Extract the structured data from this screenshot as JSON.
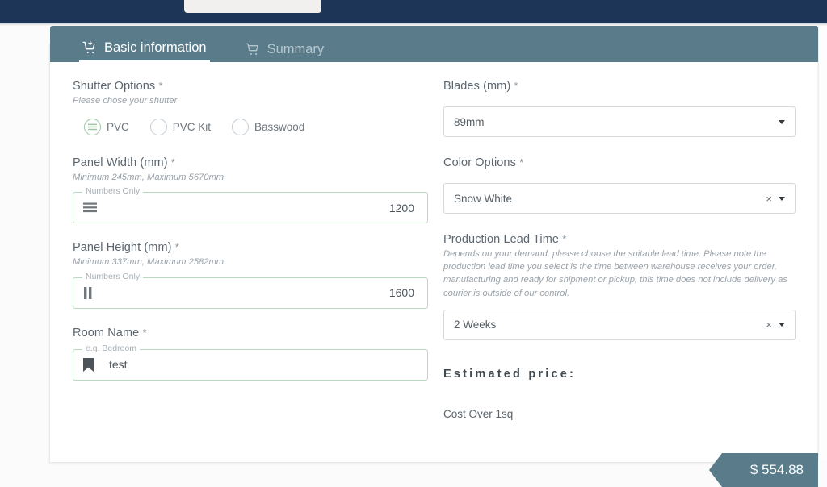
{
  "browser": {
    "tab_strip": "browser-tab"
  },
  "card": {
    "tabs": [
      {
        "label": "Basic information",
        "icon": "cart-add-icon",
        "active": true
      },
      {
        "label": "Summary",
        "icon": "cart-icon",
        "active": false
      }
    ]
  },
  "shutter": {
    "label": "Shutter Options",
    "required": "*",
    "hint": "Please chose your shutter",
    "options": [
      {
        "label": "PVC",
        "selected": true
      },
      {
        "label": "PVC Kit",
        "selected": false
      },
      {
        "label": "Basswood",
        "selected": false
      }
    ]
  },
  "panel_width": {
    "label": "Panel Width (mm)",
    "required": "*",
    "hint": "Minimum 245mm, Maximum 5670mm",
    "float_label": "Numbers Only",
    "value": "1200",
    "icon": "hamburger-lines-icon"
  },
  "panel_height": {
    "label": "Panel Height (mm)",
    "required": "*",
    "hint": "Minimum 337mm, Maximum 2582mm",
    "float_label": "Numbers Only",
    "value": "1600",
    "icon": "vertical-bars-icon"
  },
  "room_name": {
    "label": "Room Name",
    "required": "*",
    "float_label": "e.g. Bedroom",
    "value": "test",
    "icon": "bookmark-icon"
  },
  "blades": {
    "label": "Blades (mm)",
    "required": "*",
    "value": "89mm"
  },
  "color_options": {
    "label": "Color Options",
    "required": "*",
    "value": "Snow White",
    "clear": "×"
  },
  "lead_time": {
    "label": "Production Lead Time",
    "required": "*",
    "hint": "Depends on your demand, please choose the suitable lead time. Please note the production lead time you select is the time between warehouse receives your order, manufacturing and ready for shipment or pickup, this time does not include delivery as courier is outside of our control.",
    "value": "2 Weeks",
    "clear": "×"
  },
  "estimate": {
    "title": "Estimated price:",
    "cost_label": "Cost Over 1sq",
    "price": "$ 554.88"
  },
  "colors": {
    "topbar": "#1d3557",
    "tabbar": "#5a7c8a",
    "ribbon": "#5a7c8a",
    "green_border": "#b9d8bd",
    "page_bg": "#fbfbfb"
  }
}
